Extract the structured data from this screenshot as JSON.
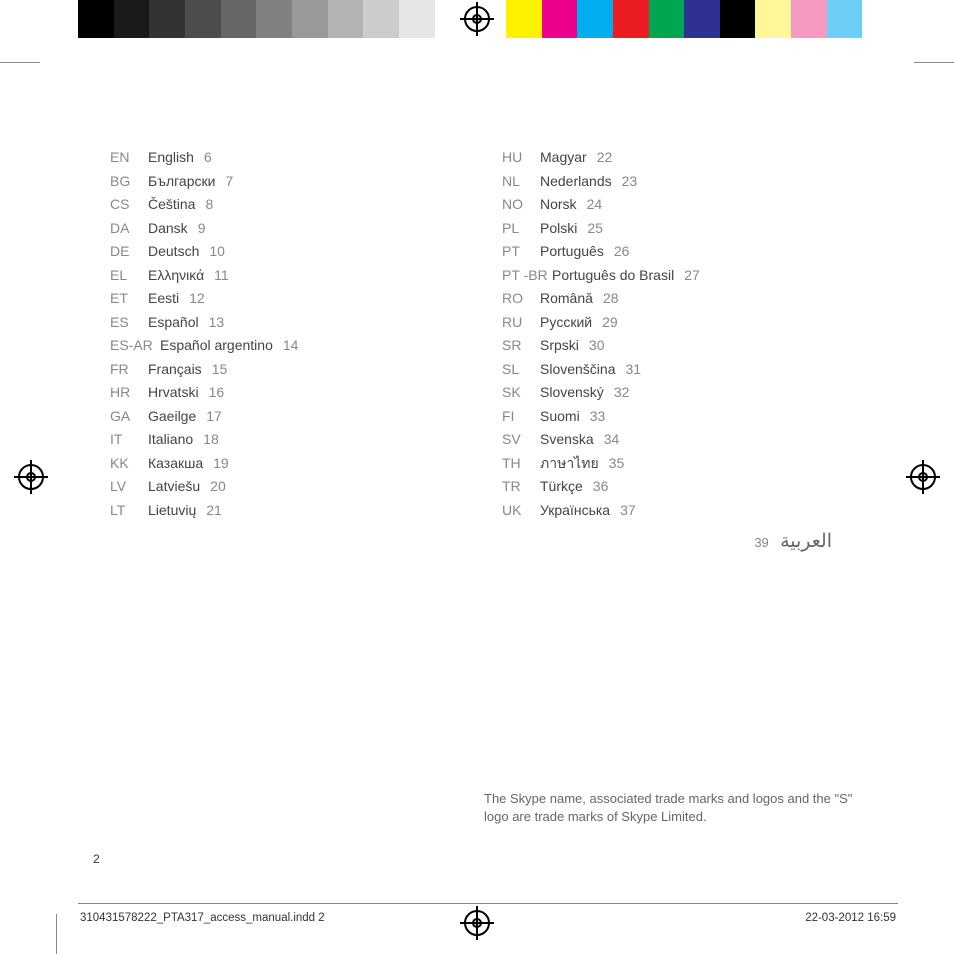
{
  "color_bar": [
    "#000000",
    "#1a1a1a",
    "#333333",
    "#4d4d4d",
    "#666666",
    "#808080",
    "#999999",
    "#b3b3b3",
    "#cccccc",
    "#e6e6e6",
    "#ffffff",
    "#ffffff",
    "#fff200",
    "#ec008c",
    "#00aeef",
    "#ec1c24",
    "#00a651",
    "#2e3192",
    "#000000",
    "#fff799",
    "#f49ac1",
    "#6dcff6",
    "#ffffff"
  ],
  "languages_left": [
    {
      "code": "EN",
      "name": "English",
      "page": "6"
    },
    {
      "code": "BG",
      "name": "Български",
      "page": "7"
    },
    {
      "code": "CS",
      "name": "Čeština",
      "page": "8"
    },
    {
      "code": "DA",
      "name": "Dansk",
      "page": "9"
    },
    {
      "code": "DE",
      "name": "Deutsch",
      "page": "10"
    },
    {
      "code": "EL",
      "name": "Ελληνικά",
      "page": "11"
    },
    {
      "code": "ET",
      "name": "Eesti",
      "page": "12"
    },
    {
      "code": "ES",
      "name": "Español",
      "page": "13"
    },
    {
      "code": "ES-AR",
      "name": "Español argentino",
      "page": "14",
      "wide": true
    },
    {
      "code": "FR",
      "name": "Français",
      "page": "15"
    },
    {
      "code": "HR",
      "name": "Hrvatski",
      "page": "16"
    },
    {
      "code": "GA",
      "name": "Gaeilge",
      "page": "17"
    },
    {
      "code": "IT",
      "name": "Italiano",
      "page": "18"
    },
    {
      "code": "KK",
      "name": "Казакша",
      "page": "19"
    },
    {
      "code": "LV",
      "name": "Latviešu",
      "page": "20"
    },
    {
      "code": "LT",
      "name": "Lietuvių",
      "page": "21"
    }
  ],
  "languages_right": [
    {
      "code": "HU",
      "name": "Magyar",
      "page": "22"
    },
    {
      "code": "NL",
      "name": "Nederlands",
      "page": "23"
    },
    {
      "code": "NO",
      "name": "Norsk",
      "page": "24"
    },
    {
      "code": "PL",
      "name": "Polski",
      "page": "25"
    },
    {
      "code": "PT",
      "name": "Português",
      "page": "26"
    },
    {
      "code": "PT -BR",
      "name": "Português do Brasil",
      "page": "27",
      "wide": true
    },
    {
      "code": "RO",
      "name": "Română",
      "page": "28"
    },
    {
      "code": "RU",
      "name": "Pyccкий",
      "page": "29"
    },
    {
      "code": "SR",
      "name": "Srpski",
      "page": "30"
    },
    {
      "code": "SL",
      "name": "Slovenščina",
      "page": "31"
    },
    {
      "code": "SK",
      "name": "Slovenský",
      "page": "32"
    },
    {
      "code": "FI",
      "name": "Suomi",
      "page": "33"
    },
    {
      "code": "SV",
      "name": "Svenska",
      "page": "34"
    },
    {
      "code": "TH",
      "name": "ภาษาไทย",
      "page": "35"
    },
    {
      "code": "TR",
      "name": "Türkçe",
      "page": "36"
    },
    {
      "code": "UK",
      "name": "Українська",
      "page": "37"
    }
  ],
  "arabic": {
    "name": "العربية",
    "page": "39"
  },
  "trademark_notice": "The Skype name, associated trade marks and logos and the \"S\" logo are trade marks of Skype Limited.",
  "page_number": "2",
  "slug": {
    "file": "310431578222_PTA317_access_manual.indd   2",
    "datetime": "22-03-2012   16:59"
  }
}
